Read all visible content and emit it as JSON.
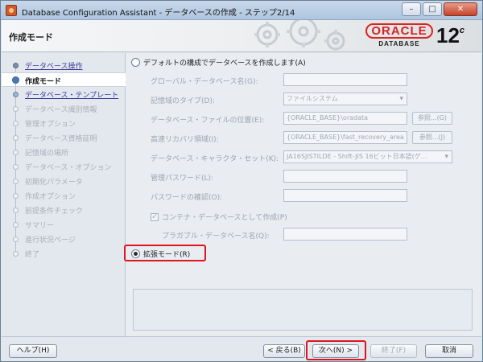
{
  "window": {
    "title": "Database Configuration Assistant - データベースの作成 - ステップ2/14",
    "minimize_label": "–",
    "maximize_label": "□",
    "close_label": "✕"
  },
  "header": {
    "title": "作成モード",
    "logo_text": "ORACLE",
    "logo_sub": "DATABASE",
    "version": "12",
    "version_suffix": "c"
  },
  "steps": [
    {
      "label": "データベース操作",
      "state": "done"
    },
    {
      "label": "作成モード",
      "state": "current"
    },
    {
      "label": "データベース・テンプレート",
      "state": "next"
    },
    {
      "label": "データベース識別情報",
      "state": "pending"
    },
    {
      "label": "管理オプション",
      "state": "pending"
    },
    {
      "label": "データベース資格証明",
      "state": "pending"
    },
    {
      "label": "記憶域の場所",
      "state": "pending"
    },
    {
      "label": "データベース・オプション",
      "state": "pending"
    },
    {
      "label": "初期化パラメータ",
      "state": "pending"
    },
    {
      "label": "作成オプション",
      "state": "pending"
    },
    {
      "label": "前提条件チェック",
      "state": "pending"
    },
    {
      "label": "サマリー",
      "state": "pending"
    },
    {
      "label": "進行状況ページ",
      "state": "pending"
    },
    {
      "label": "終了",
      "state": "pending"
    }
  ],
  "main": {
    "default_radio": "デフォルトの構成でデータベースを作成します(A)",
    "global_db_name_label": "グローバル・データベース名(G):",
    "global_db_name_value": "",
    "storage_type_label": "記憶域のタイプ(D):",
    "storage_type_value": "ファイルシステム",
    "db_file_location_label": "データベース・ファイルの位置(E):",
    "db_file_location_value": "{ORACLE_BASE}\\oradata",
    "browse1_label": "参照...(G)",
    "fra_label": "高速リカバリ領域(I):",
    "fra_value": "{ORACLE_BASE}\\fast_recovery_area",
    "browse2_label": "参照...(J)",
    "charset_label": "データベース・キャラクタ・セット(K):",
    "charset_value": "JA16SJISTILDE - Shift-JIS 16ビット日本語(ゲ...",
    "admin_pw_label": "管理パスワード(L):",
    "admin_pw_value": "",
    "confirm_pw_label": "パスワードの確認(O):",
    "confirm_pw_value": "",
    "container_check_label": "コンテナ・データベースとして作成(P)",
    "pdb_name_label": "プラガブル・データベース名(Q):",
    "pdb_name_value": "",
    "advanced_radio": "拡張モード(R)"
  },
  "footer": {
    "help": "ヘルプ(H)",
    "back": "< 戻る(B)",
    "next": "次へ(N) >",
    "finish": "終了(F)",
    "cancel": "取消"
  },
  "colors": {
    "highlight": "#e0141e",
    "oracle_red": "#d8251f",
    "link": "#3c3a98"
  }
}
